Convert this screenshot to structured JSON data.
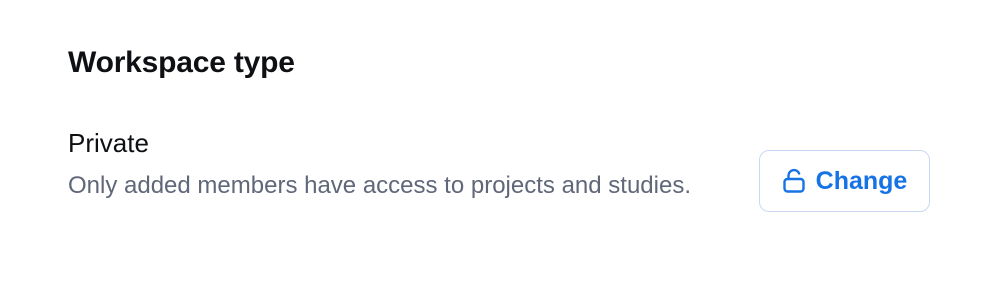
{
  "section": {
    "title": "Workspace type"
  },
  "setting": {
    "name": "Private",
    "description": "Only added members have access to projects and studies."
  },
  "actions": {
    "change_label": "Change",
    "change_icon": "unlock-icon"
  },
  "colors": {
    "accent": "#1673e5",
    "button_border": "#c9d8f2",
    "title_text": "#0e1013",
    "muted_text": "#5f6779"
  }
}
